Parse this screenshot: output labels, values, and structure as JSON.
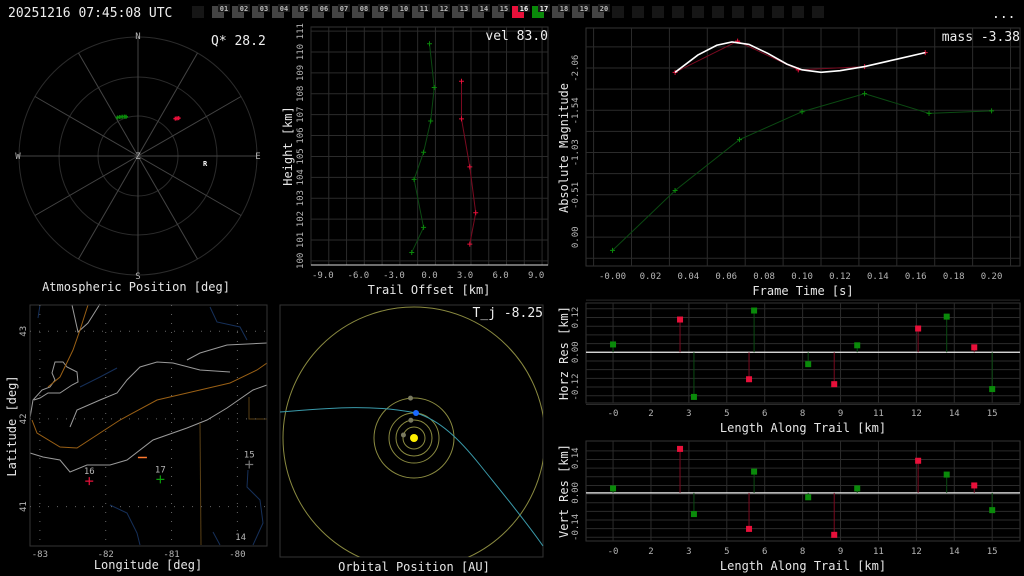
{
  "header": {
    "timestamp": "20251216 07:45:08 UTC",
    "menu_label": "...",
    "cameras": [
      {
        "label": "",
        "state": "empty"
      },
      {
        "label": "01",
        "state": "idle"
      },
      {
        "label": "02",
        "state": "idle"
      },
      {
        "label": "03",
        "state": "idle"
      },
      {
        "label": "04",
        "state": "idle"
      },
      {
        "label": "05",
        "state": "idle"
      },
      {
        "label": "06",
        "state": "idle"
      },
      {
        "label": "07",
        "state": "idle"
      },
      {
        "label": "08",
        "state": "idle"
      },
      {
        "label": "09",
        "state": "idle"
      },
      {
        "label": "10",
        "state": "idle"
      },
      {
        "label": "11",
        "state": "idle"
      },
      {
        "label": "12",
        "state": "idle"
      },
      {
        "label": "13",
        "state": "idle"
      },
      {
        "label": "14",
        "state": "idle"
      },
      {
        "label": "15",
        "state": "idle"
      },
      {
        "label": "16",
        "state": "red"
      },
      {
        "label": "17",
        "state": "green"
      },
      {
        "label": "18",
        "state": "idle"
      },
      {
        "label": "19",
        "state": "idle"
      },
      {
        "label": "20",
        "state": "idle"
      },
      {
        "label": "",
        "state": "empty"
      },
      {
        "label": "",
        "state": "empty"
      },
      {
        "label": "",
        "state": "empty"
      },
      {
        "label": "",
        "state": "empty"
      },
      {
        "label": "",
        "state": "empty"
      },
      {
        "label": "",
        "state": "empty"
      },
      {
        "label": "",
        "state": "empty"
      },
      {
        "label": "",
        "state": "empty"
      },
      {
        "label": "",
        "state": "empty"
      },
      {
        "label": "",
        "state": "empty"
      },
      {
        "label": "",
        "state": "empty"
      }
    ]
  },
  "colors": {
    "red": "#e8103a",
    "green": "#0a8a0a",
    "red_line": "#7a0a20",
    "green_line": "#0b4a12",
    "grid": "#2b2b2b"
  },
  "chart_data": [
    {
      "id": "sky",
      "type": "scatter",
      "title": "Atmospheric Position [deg]",
      "annotation": "Q* 28.2",
      "compass": {
        "n": "N",
        "s": "S",
        "e": "E",
        "w": "W",
        "zenith": "Z"
      },
      "radar_label": "R",
      "radar_pos": [
        96,
        51
      ],
      "series": [
        {
          "name": "16",
          "color": "red",
          "points": [
            [
              45,
              40
            ],
            [
              46,
              41
            ],
            [
              47,
              42
            ]
          ]
        },
        {
          "name": "17",
          "color": "green",
          "points": [
            [
              332,
              33
            ],
            [
              335,
              32.5
            ],
            [
              338,
              32
            ],
            [
              341,
              31.5
            ],
            [
              343,
              31
            ]
          ]
        }
      ]
    },
    {
      "id": "height",
      "type": "line",
      "annotation": "vel 83.0",
      "xlabel": "Trail Offset [km]",
      "ylabel": "Height [km]",
      "xlim": [
        -10,
        10
      ],
      "ylim": [
        99.8,
        111.2
      ],
      "xticks": [
        -9,
        -6,
        -3,
        0,
        3,
        6,
        9
      ],
      "xtick_labels": [
        "-9.0",
        "-6.0",
        "-3.0",
        "0.0",
        "3.0",
        "6.0",
        "9.0"
      ],
      "yticks": [
        100,
        101,
        102,
        103,
        104,
        105,
        106,
        107,
        108,
        109,
        110,
        111
      ],
      "ytick_labels": [
        "100",
        "101",
        "102",
        "103",
        "104",
        "105",
        "106",
        "107",
        "108",
        "109",
        "110",
        "111"
      ],
      "series": [
        {
          "name": "17",
          "color": "green",
          "points": [
            [
              0.0,
              110.4
            ],
            [
              0.4,
              108.3
            ],
            [
              0.1,
              106.7
            ],
            [
              -0.5,
              105.2
            ],
            [
              -1.3,
              103.9
            ],
            [
              -0.5,
              101.6
            ],
            [
              -1.5,
              100.4
            ]
          ]
        },
        {
          "name": "16",
          "color": "red",
          "points": [
            [
              2.7,
              108.6
            ],
            [
              2.7,
              106.8
            ],
            [
              3.4,
              104.5
            ],
            [
              3.9,
              102.3
            ],
            [
              3.4,
              100.8
            ]
          ]
        }
      ]
    },
    {
      "id": "magnitude",
      "type": "line",
      "annotation": "mass -3.38",
      "xlabel": "Frame Time [s]",
      "ylabel": "Absolute Magnitude",
      "xlim": [
        -0.014,
        0.215
      ],
      "ylim": [
        0.35,
        -2.55
      ],
      "xticks": [
        0,
        0.02,
        0.04,
        0.06,
        0.08,
        0.1,
        0.12,
        0.14,
        0.16,
        0.18,
        0.2
      ],
      "xtick_labels": [
        "-0.00",
        "0.02",
        "0.04",
        "0.06",
        "0.08",
        "0.10",
        "0.12",
        "0.14",
        "0.16",
        "0.18",
        "0.20"
      ],
      "yticks": [
        -2.06,
        -1.54,
        -1.03,
        -0.51,
        0.0
      ],
      "ytick_labels": [
        "-2.06",
        "-1.54",
        "-1.03",
        "-0.51",
        "0.00"
      ],
      "series": [
        {
          "name": "17",
          "color": "green",
          "points": [
            [
              0.0,
              0.16
            ],
            [
              0.033,
              -0.57
            ],
            [
              0.067,
              -1.19
            ],
            [
              0.1,
              -1.53
            ],
            [
              0.133,
              -1.75
            ],
            [
              0.167,
              -1.51
            ],
            [
              0.2,
              -1.54
            ]
          ]
        },
        {
          "name": "16",
          "color": "red",
          "points": [
            [
              0.033,
              -2.01
            ],
            [
              0.066,
              -2.39
            ],
            [
              0.098,
              -2.04
            ],
            [
              0.133,
              -2.08
            ],
            [
              0.165,
              -2.25
            ]
          ]
        },
        {
          "name": "fit",
          "color": "white",
          "points": [
            [
              0.033,
              -2.01
            ],
            [
              0.045,
              -2.22
            ],
            [
              0.055,
              -2.34
            ],
            [
              0.063,
              -2.38
            ],
            [
              0.072,
              -2.35
            ],
            [
              0.082,
              -2.24
            ],
            [
              0.092,
              -2.11
            ],
            [
              0.1,
              -2.04
            ],
            [
              0.11,
              -2.01
            ],
            [
              0.12,
              -2.03
            ],
            [
              0.133,
              -2.08
            ],
            [
              0.15,
              -2.17
            ],
            [
              0.165,
              -2.25
            ]
          ]
        }
      ]
    },
    {
      "id": "horz_res",
      "type": "scatter",
      "xlabel": "Length Along Trail [km]",
      "ylabel": "Horz Res [km]",
      "xlim": [
        -1.07,
        16.1
      ],
      "ylim": [
        -0.175,
        0.17
      ],
      "xticks": [
        0,
        1.5,
        3,
        4.5,
        6,
        7.5,
        9,
        10.5,
        12,
        13.5,
        15
      ],
      "xtick_labels": [
        "-0",
        "2",
        "3",
        "5",
        "6",
        "8",
        "9",
        "11",
        "12",
        "14",
        "15"
      ],
      "yticks": [
        -0.12,
        0.0,
        0.12
      ],
      "ytick_labels": [
        "-0.12",
        "0.00",
        "0.12"
      ],
      "series": [
        {
          "name": "17",
          "color": "green",
          "points": [
            [
              0.0,
              0.027
            ],
            [
              3.2,
              -0.154
            ],
            [
              5.58,
              0.144
            ],
            [
              7.72,
              -0.041
            ],
            [
              9.66,
              0.024
            ],
            [
              13.2,
              0.123
            ],
            [
              15.0,
              -0.127
            ]
          ]
        },
        {
          "name": "16",
          "color": "red",
          "points": [
            [
              2.65,
              0.113
            ],
            [
              5.38,
              -0.093
            ],
            [
              8.75,
              -0.11
            ],
            [
              12.07,
              0.082
            ],
            [
              14.29,
              0.017
            ]
          ]
        }
      ]
    },
    {
      "id": "vert_res",
      "type": "scatter",
      "xlabel": "Length Along Trail [km]",
      "ylabel": "Vert Res [km]",
      "xlim": [
        -1.07,
        16.1
      ],
      "ylim": [
        -0.195,
        0.21
      ],
      "xticks": [
        0,
        1.5,
        3,
        4.5,
        6,
        7.5,
        9,
        10.5,
        12,
        13.5,
        15
      ],
      "xtick_labels": [
        "-0",
        "2",
        "3",
        "5",
        "6",
        "8",
        "9",
        "11",
        "12",
        "14",
        "15"
      ],
      "yticks": [
        -0.14,
        0.0,
        0.14
      ],
      "ytick_labels": [
        "-0.14",
        "0.00",
        "0.14"
      ],
      "series": [
        {
          "name": "17",
          "color": "green",
          "points": [
            [
              0.0,
              0.018
            ],
            [
              3.2,
              -0.086
            ],
            [
              5.58,
              0.086
            ],
            [
              7.72,
              -0.018
            ],
            [
              9.66,
              0.018
            ],
            [
              13.2,
              0.074
            ],
            [
              15.0,
              -0.07
            ]
          ]
        },
        {
          "name": "16",
          "color": "red",
          "points": [
            [
              2.65,
              0.178
            ],
            [
              5.38,
              -0.146
            ],
            [
              8.75,
              -0.17
            ],
            [
              12.07,
              0.13
            ],
            [
              14.29,
              0.03
            ]
          ]
        }
      ]
    },
    {
      "id": "map",
      "type": "scatter",
      "xlabel": "Longitude [deg]",
      "ylabel": "Latitude [deg]",
      "xlim": [
        -83.15,
        -79.55
      ],
      "ylim": [
        40.55,
        43.3
      ],
      "xticks": [
        -83,
        -82,
        -81,
        -80
      ],
      "xtick_labels": [
        "-83",
        "-82",
        "-81",
        "-80"
      ],
      "yticks": [
        41,
        42,
        43
      ],
      "ytick_labels": [
        "41",
        "42",
        "43"
      ],
      "stations": [
        {
          "label": "16",
          "lon": -82.25,
          "lat": 41.29,
          "color": "#e8103a"
        },
        {
          "label": "17",
          "lon": -81.17,
          "lat": 41.31,
          "color": "#0a9a0a"
        },
        {
          "label": "15",
          "lon": -79.82,
          "lat": 41.48,
          "color": "#777777"
        }
      ],
      "extra_labels": [
        {
          "label": "14",
          "lon": -79.95,
          "lat": 40.62
        }
      ],
      "trail": {
        "lon": -81.45,
        "lat": 41.56
      }
    },
    {
      "id": "orbit",
      "type": "scatter",
      "title": "Orbital Position [AU]",
      "annotation": "T_j -8.25",
      "orbits_au": [
        0.39,
        0.72,
        1.0,
        1.52,
        5.2
      ],
      "planets_deg": [
        196,
        260,
        85,
        265,
        100
      ],
      "earth_index": 2
    }
  ]
}
